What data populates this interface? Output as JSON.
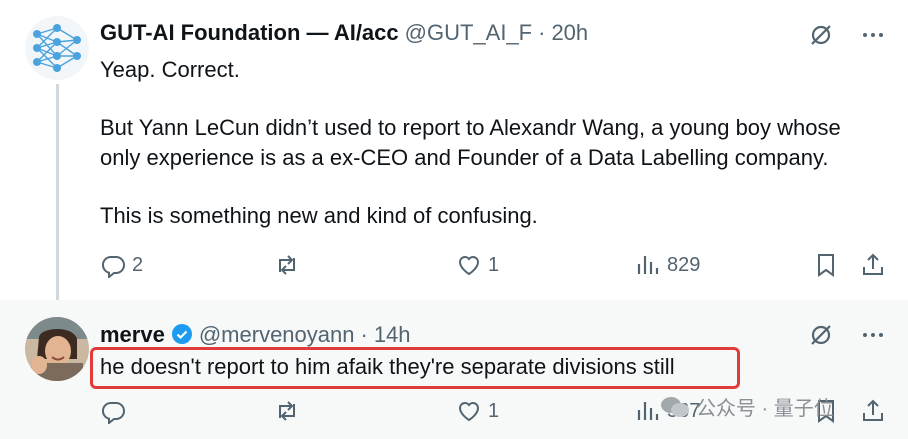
{
  "tweet1": {
    "author_name": "GUT-AI Foundation — AI/acc",
    "handle": "@GUT_AI_F",
    "separator": "·",
    "time": "20h",
    "line1": "Yeap. Correct.",
    "para2_line1": "But Yann LeCun didn’t used to report to Alexandr Wang, a young boy whose",
    "para2_line2": "only experience is as a ex-CEO and Founder of a Data Labelling company.",
    "para3": "This is something new and kind of confusing.",
    "replies": "2",
    "retweets": "",
    "likes": "1",
    "views": "829"
  },
  "tweet2": {
    "author_name": "merve",
    "handle": "@mervenoyann",
    "separator": "·",
    "time": "14h",
    "text": "he doesn't report to him afaik they're separate divisions still",
    "replies": "",
    "retweets": "",
    "likes": "1",
    "views": "567"
  },
  "watermark": {
    "text": "公众号 · 量子位"
  },
  "colors": {
    "text": "#0f1419",
    "muted": "#536471",
    "verified": "#1d9bf0",
    "highlight_border": "#e03c3c",
    "thread_line": "#cfd9de"
  },
  "icons": [
    "neural-network-logo",
    "grok-icon",
    "more-icon",
    "reply-icon",
    "retweet-icon",
    "like-icon",
    "views-icon",
    "bookmark-icon",
    "share-icon",
    "verified-badge-icon"
  ]
}
